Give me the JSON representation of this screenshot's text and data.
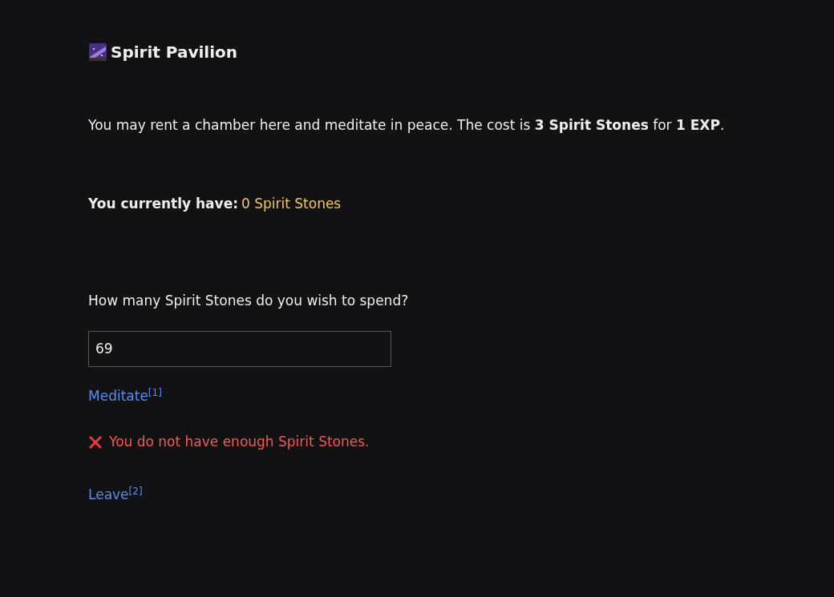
{
  "title": "Spirit Pavilion",
  "intro": "You may rent a chamber here and meditate in peace. The cost is **3 Spirit Stones** for **1 EXP**.",
  "balance": {
    "label": "You currently have:",
    "value": "0 Spirit Stones"
  },
  "question": "How many Spirit Stones do you wish to spend?",
  "amount_field": {
    "value": "69"
  },
  "actions": [
    {
      "kind": "link",
      "text": "Meditate$^{[1]}$"
    },
    {
      "kind": "error",
      "text": "You do not have enough Spirit Stones."
    },
    {
      "kind": "link",
      "text": "Leave$^{[2]}$"
    }
  ]
}
